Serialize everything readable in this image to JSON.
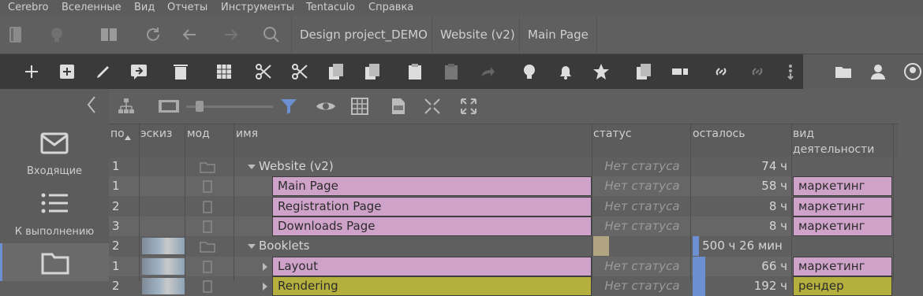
{
  "menu": [
    "Cerebro",
    "Вселенные",
    "Вид",
    "Отчеты",
    "Инструменты",
    "Tentaculo",
    "Справка"
  ],
  "breadcrumbs": [
    "Design project_DEMO",
    "Website (v2)",
    "Main Page"
  ],
  "sidebar": [
    {
      "label": "Входящие",
      "icon": "inbox-icon"
    },
    {
      "label": "К выполнению",
      "icon": "todo-list-icon"
    },
    {
      "label": "",
      "icon": "folder-icon"
    }
  ],
  "columns": {
    "num": "по",
    "thumb": "эскиз",
    "mod": "мод",
    "name": "имя",
    "status": "статус",
    "left": "осталось",
    "activity": "вид\nдеятельности"
  },
  "rows": [
    {
      "num": "1",
      "name": "Website (v2)",
      "status": "Нет статуса",
      "left": "74 ч",
      "activity": "",
      "level": 0,
      "expand": "down",
      "style": "none",
      "thumb": false
    },
    {
      "num": "1",
      "name": "Main Page",
      "status": "Нет статуса",
      "left": "58 ч",
      "activity": "маркетинг",
      "level": 1,
      "expand": "",
      "style": "pink",
      "thumb": false
    },
    {
      "num": "2",
      "name": "Registration Page",
      "status": "Нет статуса",
      "left": "8 ч",
      "activity": "маркетинг",
      "level": 1,
      "expand": "",
      "style": "pink",
      "thumb": false
    },
    {
      "num": "3",
      "name": "Downloads Page",
      "status": "Нет статуса",
      "left": "8 ч",
      "activity": "маркетинг",
      "level": 1,
      "expand": "",
      "style": "pink",
      "thumb": false
    },
    {
      "num": "2",
      "name": "Booklets",
      "status": "",
      "left": "500 ч 26 мин",
      "activity": "",
      "level": 0,
      "expand": "down",
      "style": "none",
      "thumb": true
    },
    {
      "num": "1",
      "name": "Layout",
      "status": "Нет статуса",
      "left": "66 ч",
      "activity": "маркетинг",
      "level": 1,
      "expand": "right",
      "style": "pink",
      "thumb": true
    },
    {
      "num": "2",
      "name": "Rendering",
      "status": "Нет статуса",
      "left": "192 ч",
      "activity": "рендер",
      "level": 1,
      "expand": "right",
      "style": "yellow",
      "thumb": true
    }
  ],
  "colors": {
    "pink": "#cfa3c9",
    "yellow": "#b5b03e",
    "accent": "#6b8fd1"
  }
}
